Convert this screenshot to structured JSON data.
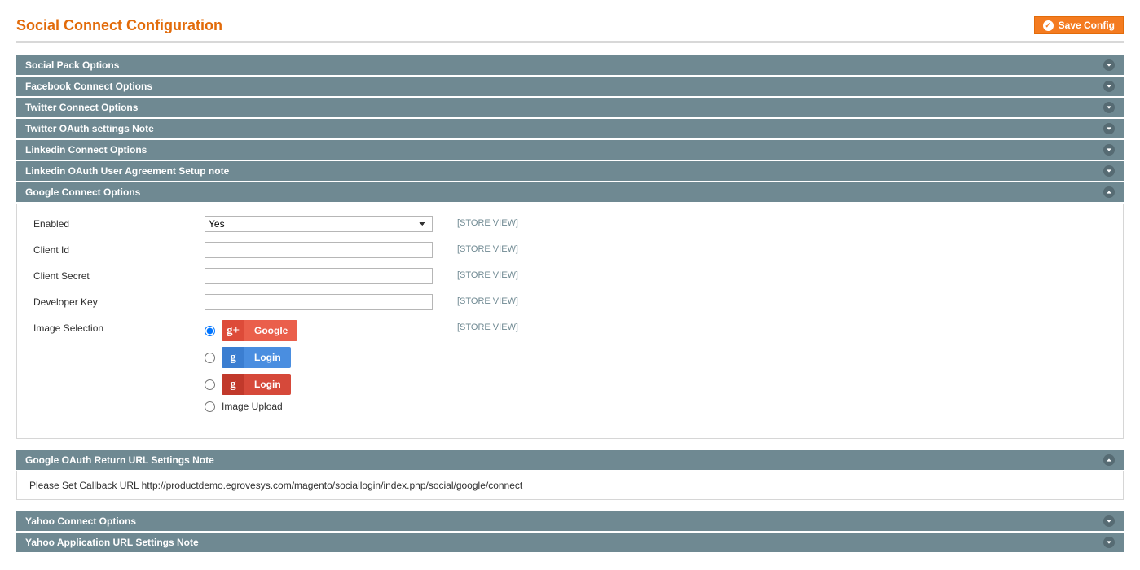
{
  "page": {
    "title": "Social Connect Configuration",
    "save_button_label": "Save Config"
  },
  "sections": {
    "social_pack": {
      "title": "Social Pack Options"
    },
    "facebook": {
      "title": "Facebook Connect Options"
    },
    "twitter": {
      "title": "Twitter Connect Options"
    },
    "twitter_oauth_note": {
      "title": "Twitter OAuth settings Note"
    },
    "linkedin": {
      "title": "Linkedin Connect Options"
    },
    "linkedin_oauth_note": {
      "title": "Linkedin OAuth User Agreement Setup note"
    },
    "google": {
      "title": "Google Connect Options",
      "fields": {
        "enabled": {
          "label": "Enabled",
          "value": "Yes",
          "scope": "[STORE VIEW]"
        },
        "client_id": {
          "label": "Client Id",
          "value": "",
          "scope": "[STORE VIEW]"
        },
        "client_secret": {
          "label": "Client Secret",
          "value": "",
          "scope": "[STORE VIEW]"
        },
        "developer_key": {
          "label": "Developer Key",
          "value": "",
          "scope": "[STORE VIEW]"
        },
        "image_selection": {
          "label": "Image Selection",
          "scope": "[STORE VIEW]",
          "options": {
            "opt1_label": "Google",
            "opt2_label": "Login",
            "opt3_label": "Login",
            "opt4_label": "Image Upload"
          }
        }
      }
    },
    "google_oauth_note": {
      "title": "Google OAuth Return URL Settings Note",
      "body": "Please Set Callback URL http://productdemo.egrovesys.com/magento/sociallogin/index.php/social/google/connect"
    },
    "yahoo": {
      "title": "Yahoo Connect Options"
    },
    "yahoo_app_note": {
      "title": "Yahoo Application URL Settings Note"
    }
  }
}
